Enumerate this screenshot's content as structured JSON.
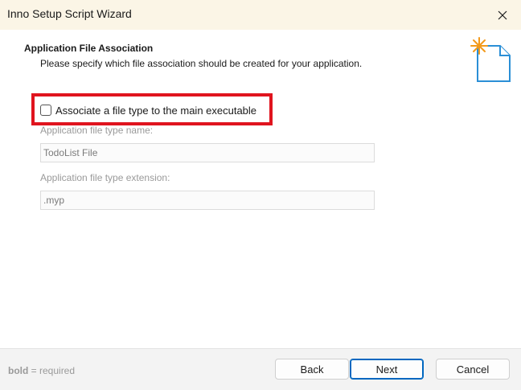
{
  "window": {
    "title": "Inno Setup Script Wizard",
    "close_icon": "close-icon"
  },
  "header": {
    "title": "Application File Association",
    "subtitle": "Please specify which file association should be created for your application.",
    "icon": "new-document-sparkle-icon"
  },
  "form": {
    "associate_checkbox": {
      "label": "Associate a file type to the main executable",
      "checked": false
    },
    "file_type_name": {
      "label": "Application file type name:",
      "value": "TodoList File",
      "disabled": true
    },
    "file_type_extension": {
      "label": "Application file type extension:",
      "value": ".myp",
      "disabled": true
    }
  },
  "annotation": {
    "highlight_color": "#e0141e"
  },
  "footer": {
    "legend_bold": "bold",
    "legend_rest": " = required",
    "back_label": "Back",
    "next_label": "Next",
    "cancel_label": "Cancel"
  }
}
